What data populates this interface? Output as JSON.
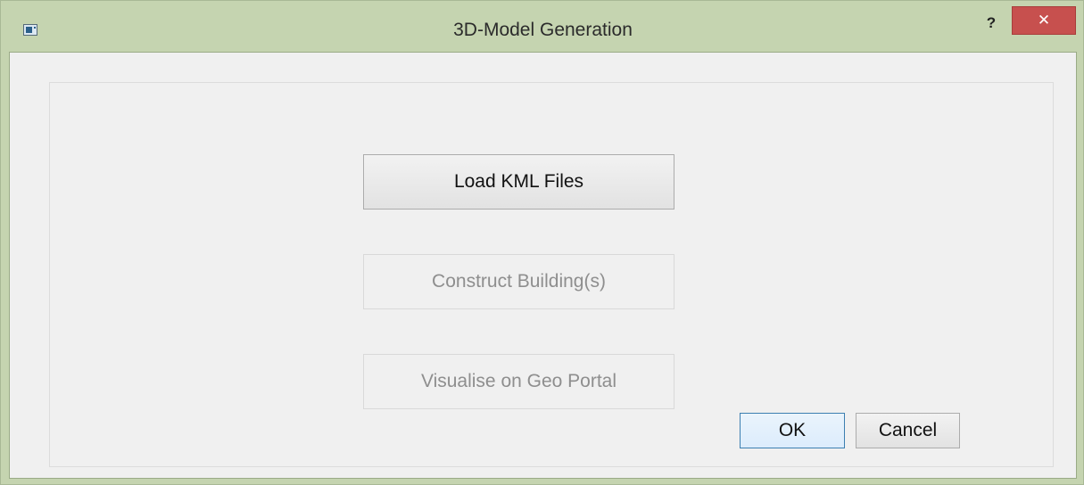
{
  "window": {
    "title": "3D-Model Generation",
    "help_label": "?",
    "close_label": "✕"
  },
  "buttons": {
    "load_kml": "Load KML Files",
    "construct": "Construct Building(s)",
    "visualise": "Visualise on Geo Portal",
    "ok": "OK",
    "cancel": "Cancel"
  },
  "colors": {
    "frame": "#c5d4b0",
    "close_button": "#c7504e",
    "client_background": "#f0f0f0",
    "default_button_border": "#3c7fb1"
  }
}
